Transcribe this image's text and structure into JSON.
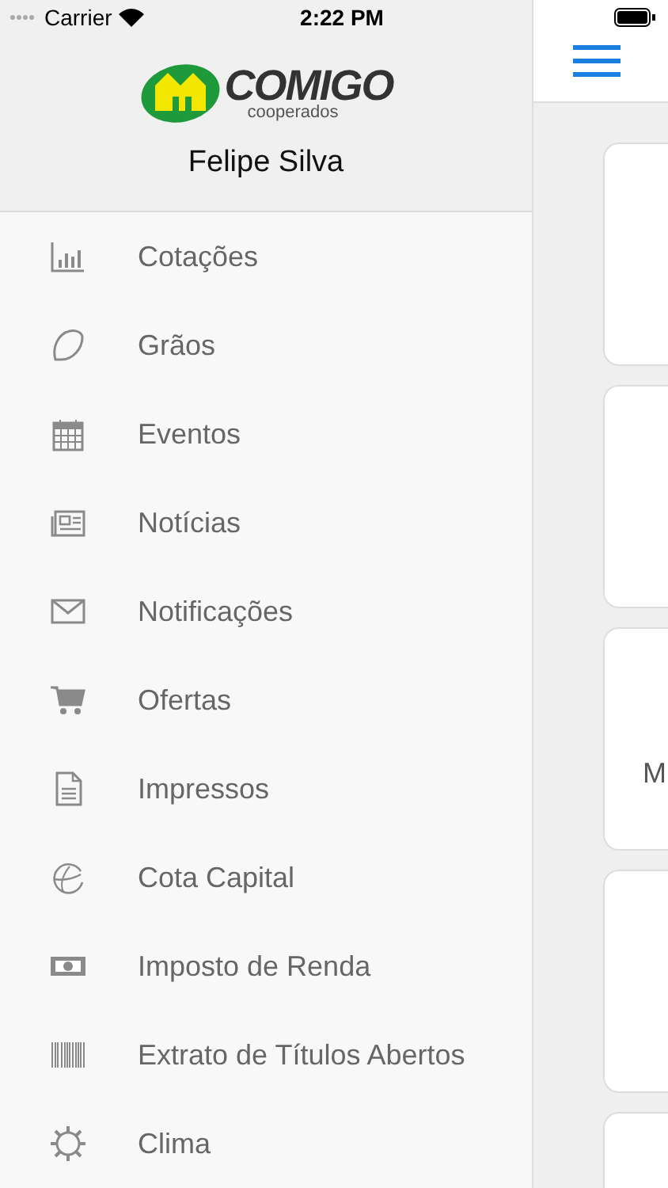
{
  "status_bar": {
    "carrier": "Carrier",
    "time": "2:22 PM"
  },
  "drawer": {
    "logo": {
      "name": "COMIGO",
      "tagline": "cooperados"
    },
    "user_name": "Felipe Silva",
    "menu": [
      {
        "label": "Cotações"
      },
      {
        "label": "Grãos"
      },
      {
        "label": "Eventos"
      },
      {
        "label": "Notícias"
      },
      {
        "label": "Notificações"
      },
      {
        "label": "Ofertas"
      },
      {
        "label": "Impressos"
      },
      {
        "label": "Cota Capital"
      },
      {
        "label": "Imposto de Renda"
      },
      {
        "label": "Extrato de Títulos Abertos"
      },
      {
        "label": "Clima"
      }
    ]
  },
  "content": {
    "cards": [
      {
        "kind": "blank"
      },
      {
        "kind": "blank"
      },
      {
        "kind": "text",
        "text": "M"
      },
      {
        "kind": "blank"
      },
      {
        "kind": "blank"
      }
    ]
  }
}
